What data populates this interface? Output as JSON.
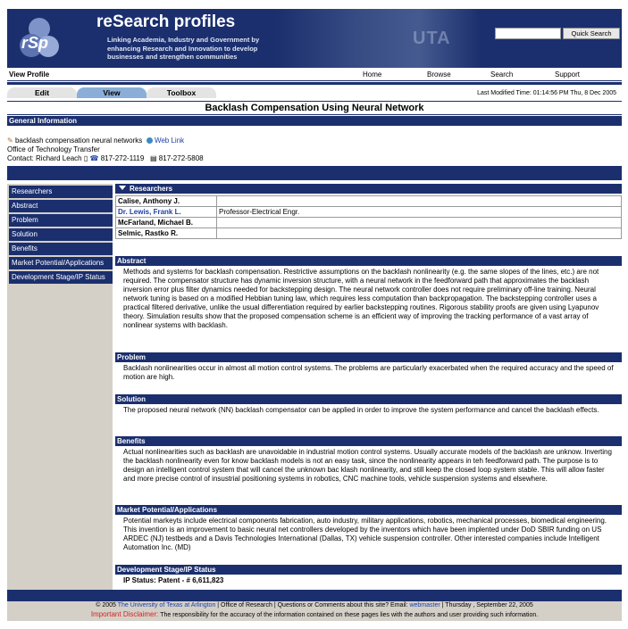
{
  "header": {
    "brand": "reSearch profiles",
    "logo_text": "rSp",
    "tagline": "Linking Academia, Industry and Government by enhancing Research and Innovation to develop businesses and strengthen communities",
    "banner_word": "UTA",
    "search_value": "",
    "search_button": "Quick Search"
  },
  "nav": {
    "view_profile": "View Profile",
    "links": [
      "Home",
      "Browse",
      "Search",
      "Support"
    ]
  },
  "tabs": [
    "Edit",
    "View",
    "Toolbox"
  ],
  "active_tab": "View",
  "last_modified": "Last Modified Time: 01:14:56 PM Thu, 8 Dec 2005",
  "title": "Backlash Compensation Using Neural Network",
  "general": {
    "header": "General Information",
    "keywords": "backlash compensation neural networks",
    "web_link": "Web Link",
    "office": "Office of Technology Transfer",
    "contact_label": "Contact: Richard Leach",
    "phone": "817-272-1119",
    "fax": "817-272-5808"
  },
  "sidebar": {
    "items": [
      "Researchers",
      "Abstract",
      "Problem",
      "Solution",
      "Benefits",
      "Market Potential/Applications",
      "Development Stage/IP Status"
    ]
  },
  "researchers": {
    "header": "Researchers",
    "rows": [
      {
        "name": "Calise, Anthony J.",
        "title": ""
      },
      {
        "name": "Dr. Lewis, Frank L.",
        "title": "Professor-Electrical Engr."
      },
      {
        "name": "McFarland, Michael B.",
        "title": ""
      },
      {
        "name": "Selmic, Rastko R.",
        "title": ""
      }
    ]
  },
  "sections": {
    "abstract": {
      "header": "Abstract",
      "body": "Methods and systems for backlash compensation. Restrictive assumptions on the backlash nonlinearity (e.g. the same slopes of the lines, etc.) are not required. The compensator structure has dynamic inversion structure, with a neural network in the feedforward path that approximates the backlash inversion error plus filter dynamics needed for backstepping design. The neural network controller does not require preliminary off-line training. Neural network tuning is based on a modified Hebbian tuning law, which requires less computation than backpropagation. The backstepping controller uses a practical filtered derivative, unlike the usual differentiation required by earlier backstepping routines. Rigorous stability proofs are given using Lyapunov theory. Simulation results show that the proposed compensation scheme is an efficient way of improving the tracking performance of a vast array of nonlinear systems with backlash."
    },
    "problem": {
      "header": "Problem",
      "body": "Backlash nonlinearities occur in almost all motion control systems.  The problems are particularly exacerbated when the required accuracy and the speed of motion are high."
    },
    "solution": {
      "header": "Solution",
      "body": "The proposed neural network (NN) backlash compensator can be applied in order to improve the system performance and cancel the backlash effects."
    },
    "benefits": {
      "header": "Benefits",
      "body": "Actual nonlinearities such as backlash are unavoidable in industrial motion control systems.  Usually accurate models of the backlash are unknow.  Inverting the backlash nonlinearity even for know backlash models is not an easy task, since the nonlinearity appears in teh feedforward path.  The purpose is to design an intelligent control system that will cancel the unknown bac klash nonlinearity, and still keep the closed loop system stable.  This will allow faster and more precise control of insustrial positioning systems in robotics, CNC machine tools, vehicle suspension systems and elsewhere."
    },
    "market": {
      "header": "Market Potential/Applications",
      "body": "Potential markeyts include electrical components fabrication, auto industry, military applications, robotics, mechanical processes, biomedical engineering.  This invention is an improvement to basic neural net controllers developed by the inventors which have been implented under DoD SBIR funding on US ARDEC (NJ) testbeds and a Davis Technologies International (Dallas, TX) vehicle suspension controller.  Other interested companies include Intelligent Automation Inc. (MD)"
    },
    "status": {
      "header": "Development Stage/IP Status",
      "body": "IP Status: Patent - # 6,611,823"
    }
  },
  "footer": {
    "copyright": "© 2005",
    "university": "The University of Texas at Arlington",
    "middle": "| Office of Research | Questions or Comments about this site? Email:",
    "webmaster": "webmaster",
    "date": "| Thursday , September 22, 2005",
    "disclaimer_label": "Important Disclaimer:",
    "disclaimer": "The responsibility for the accuracy of the information contained on these pages lies with the authors and user providing such information."
  },
  "colors": {
    "brand_navy": "#1b2f6e",
    "tab_active": "#8aaed8",
    "link_blue": "#1b3fa8",
    "sidebar_gray": "#d4d0c8"
  }
}
